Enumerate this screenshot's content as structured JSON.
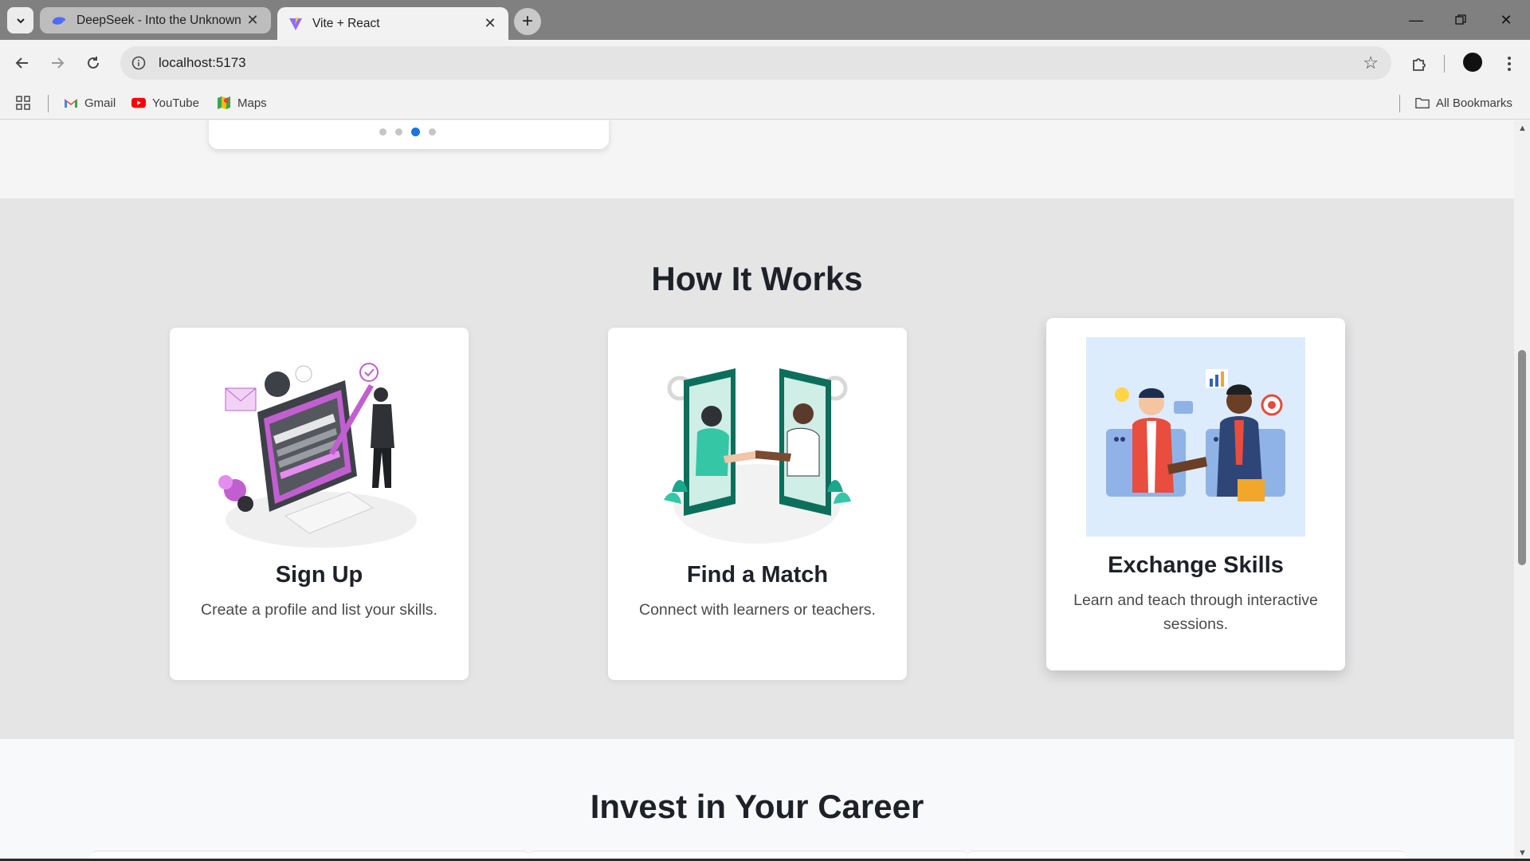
{
  "browser": {
    "tabs": [
      {
        "title": "DeepSeek - Into the Unknown",
        "icon": "deepseek-whale-icon",
        "active": false
      },
      {
        "title": "Vite + React",
        "icon": "vite-logo-icon",
        "active": true
      }
    ],
    "url": "localhost:5173",
    "bookmarks": [
      {
        "label": "Gmail",
        "icon": "gmail-icon"
      },
      {
        "label": "YouTube",
        "icon": "youtube-icon"
      },
      {
        "label": "Maps",
        "icon": "maps-icon"
      }
    ],
    "all_bookmarks_label": "All Bookmarks"
  },
  "carousel": {
    "dot_count": 4,
    "active_dot_index": 2
  },
  "how_it_works": {
    "title": "How It Works",
    "steps": [
      {
        "title": "Sign Up",
        "description": "Create a profile and list your skills.",
        "illustration": "sign-up-illustration"
      },
      {
        "title": "Find a Match",
        "description": "Connect with learners or teachers.",
        "illustration": "handshake-phones-illustration"
      },
      {
        "title": "Exchange Skills",
        "description": "Learn and teach through interactive sessions.",
        "illustration": "skill-exchange-illustration"
      }
    ]
  },
  "invest": {
    "title": "Invest in Your Career"
  },
  "colors": {
    "accent": "#1a73e8",
    "section_bg": "#e5e5e6",
    "heading": "#1e2128",
    "purple": "#c15fd1",
    "teal": "#1aa88a"
  }
}
